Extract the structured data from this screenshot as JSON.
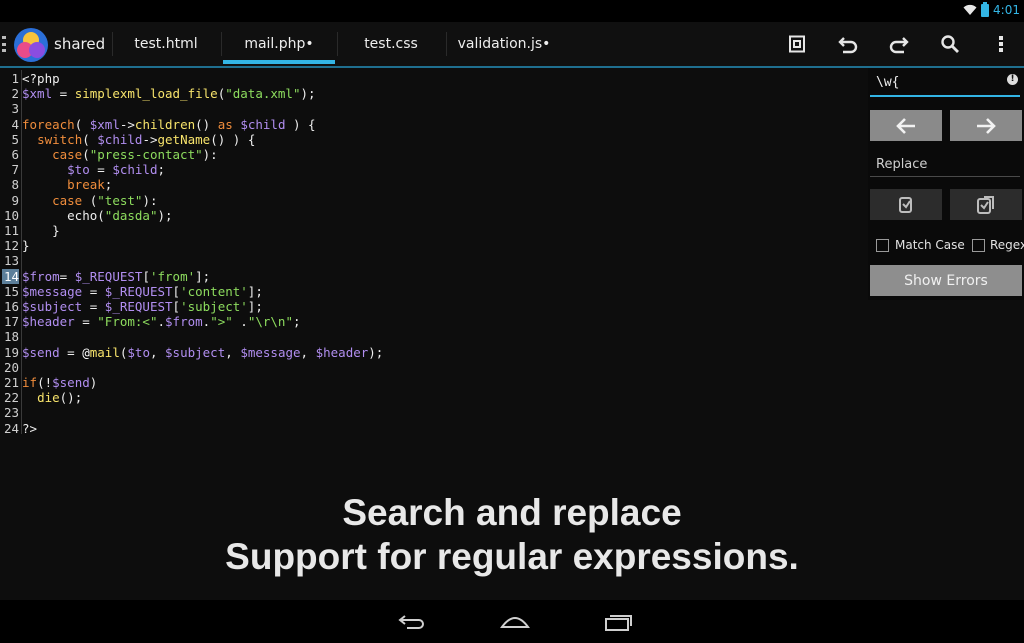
{
  "status": {
    "time": "4:01"
  },
  "actionbar": {
    "app_label": "shared",
    "tabs": [
      {
        "label": "test.html"
      },
      {
        "label": "mail.php•"
      },
      {
        "label": "test.css"
      },
      {
        "label": "validation.js•"
      }
    ],
    "icons": [
      "save-icon",
      "undo-icon",
      "redo-icon",
      "search-icon",
      "overflow-menu-icon"
    ]
  },
  "editor": {
    "highlighted_line": 14,
    "line_numbers": [
      "1",
      "2",
      "3",
      "4",
      "5",
      "6",
      "7",
      "8",
      "9",
      "10",
      "11",
      "12",
      "13",
      "14",
      "15",
      "16",
      "17",
      "18",
      "19",
      "20",
      "21",
      "22",
      "23",
      "24"
    ],
    "lines": [
      [
        {
          "t": "<?php",
          "c": "op"
        }
      ],
      [
        {
          "t": "$xml",
          "c": "var"
        },
        {
          "t": " = ",
          "c": "op"
        },
        {
          "t": "simplexml_load_file",
          "c": "fn"
        },
        {
          "t": "(",
          "c": "op"
        },
        {
          "t": "\"data.xml\"",
          "c": "str"
        },
        {
          "t": ");",
          "c": "op"
        }
      ],
      [],
      [
        {
          "t": "foreach",
          "c": "kw"
        },
        {
          "t": "( ",
          "c": "op"
        },
        {
          "t": "$xml",
          "c": "var"
        },
        {
          "t": "->",
          "c": "op"
        },
        {
          "t": "children",
          "c": "fn"
        },
        {
          "t": "() ",
          "c": "op"
        },
        {
          "t": "as",
          "c": "kw"
        },
        {
          "t": " ",
          "c": "op"
        },
        {
          "t": "$child",
          "c": "var"
        },
        {
          "t": " ) {",
          "c": "op"
        }
      ],
      [
        {
          "t": "  ",
          "c": "op"
        },
        {
          "t": "switch",
          "c": "kw"
        },
        {
          "t": "( ",
          "c": "op"
        },
        {
          "t": "$child",
          "c": "var"
        },
        {
          "t": "->",
          "c": "op"
        },
        {
          "t": "getName",
          "c": "fn"
        },
        {
          "t": "() ) {",
          "c": "op"
        }
      ],
      [
        {
          "t": "    ",
          "c": "op"
        },
        {
          "t": "case",
          "c": "kw"
        },
        {
          "t": "(",
          "c": "op"
        },
        {
          "t": "\"press-contact\"",
          "c": "str"
        },
        {
          "t": "):",
          "c": "op"
        }
      ],
      [
        {
          "t": "      ",
          "c": "op"
        },
        {
          "t": "$to",
          "c": "var"
        },
        {
          "t": " = ",
          "c": "op"
        },
        {
          "t": "$child",
          "c": "var"
        },
        {
          "t": ";",
          "c": "op"
        }
      ],
      [
        {
          "t": "      ",
          "c": "op"
        },
        {
          "t": "break",
          "c": "kw"
        },
        {
          "t": ";",
          "c": "op"
        }
      ],
      [
        {
          "t": "    ",
          "c": "op"
        },
        {
          "t": "case",
          "c": "kw"
        },
        {
          "t": " (",
          "c": "op"
        },
        {
          "t": "\"test\"",
          "c": "str"
        },
        {
          "t": "):",
          "c": "op"
        }
      ],
      [
        {
          "t": "      echo(",
          "c": "op"
        },
        {
          "t": "\"dasda\"",
          "c": "str"
        },
        {
          "t": ");",
          "c": "op"
        }
      ],
      [
        {
          "t": "    }",
          "c": "op"
        }
      ],
      [
        {
          "t": "}",
          "c": "op"
        }
      ],
      [],
      [
        {
          "t": "$from",
          "c": "var"
        },
        {
          "t": "= ",
          "c": "op"
        },
        {
          "t": "$_REQUEST",
          "c": "var"
        },
        {
          "t": "[",
          "c": "op"
        },
        {
          "t": "'from'",
          "c": "str"
        },
        {
          "t": "];",
          "c": "op"
        }
      ],
      [
        {
          "t": "$message",
          "c": "var"
        },
        {
          "t": " = ",
          "c": "op"
        },
        {
          "t": "$_REQUEST",
          "c": "var"
        },
        {
          "t": "[",
          "c": "op"
        },
        {
          "t": "'content'",
          "c": "str"
        },
        {
          "t": "];",
          "c": "op"
        }
      ],
      [
        {
          "t": "$subject",
          "c": "var"
        },
        {
          "t": " = ",
          "c": "op"
        },
        {
          "t": "$_REQUEST",
          "c": "var"
        },
        {
          "t": "[",
          "c": "op"
        },
        {
          "t": "'subject'",
          "c": "str"
        },
        {
          "t": "];",
          "c": "op"
        }
      ],
      [
        {
          "t": "$header",
          "c": "var"
        },
        {
          "t": " = ",
          "c": "op"
        },
        {
          "t": "\"From:<\"",
          "c": "str"
        },
        {
          "t": ".",
          "c": "op"
        },
        {
          "t": "$from",
          "c": "var"
        },
        {
          "t": ".",
          "c": "op"
        },
        {
          "t": "\">\"",
          "c": "str"
        },
        {
          "t": " .",
          "c": "op"
        },
        {
          "t": "\"\\r\\n\"",
          "c": "str"
        },
        {
          "t": ";",
          "c": "op"
        }
      ],
      [],
      [
        {
          "t": "$send",
          "c": "var"
        },
        {
          "t": " = ",
          "c": "op"
        },
        {
          "t": "@",
          "c": "at"
        },
        {
          "t": "mail",
          "c": "fn"
        },
        {
          "t": "(",
          "c": "op"
        },
        {
          "t": "$to",
          "c": "var"
        },
        {
          "t": ", ",
          "c": "op"
        },
        {
          "t": "$subject",
          "c": "var"
        },
        {
          "t": ", ",
          "c": "op"
        },
        {
          "t": "$message",
          "c": "var"
        },
        {
          "t": ", ",
          "c": "op"
        },
        {
          "t": "$header",
          "c": "var"
        },
        {
          "t": ");",
          "c": "op"
        }
      ],
      [],
      [
        {
          "t": "if",
          "c": "kw"
        },
        {
          "t": "(!",
          "c": "op"
        },
        {
          "t": "$send",
          "c": "var"
        },
        {
          "t": ")",
          "c": "op"
        }
      ],
      [
        {
          "t": "  ",
          "c": "op"
        },
        {
          "t": "die",
          "c": "fn"
        },
        {
          "t": "();",
          "c": "op"
        }
      ],
      [],
      [
        {
          "t": "?>",
          "c": "op"
        }
      ]
    ]
  },
  "caption": {
    "line1": "Search and replace",
    "line2": "Support for regular expressions."
  },
  "search_panel": {
    "search_value": "\\w{",
    "info_label": "!",
    "replace_placeholder": "Replace",
    "match_case_label": "Match Case",
    "regex_label": "Regex",
    "show_errors_label": "Show Errors"
  },
  "navbar": {
    "icons": [
      "back-icon",
      "home-icon",
      "recent-apps-icon"
    ]
  },
  "colors": {
    "accent": "#33b5e5",
    "keyword": "#f08d3c",
    "variable": "#b18ef0",
    "function": "#f7e36b",
    "string": "#8ddc5e"
  }
}
